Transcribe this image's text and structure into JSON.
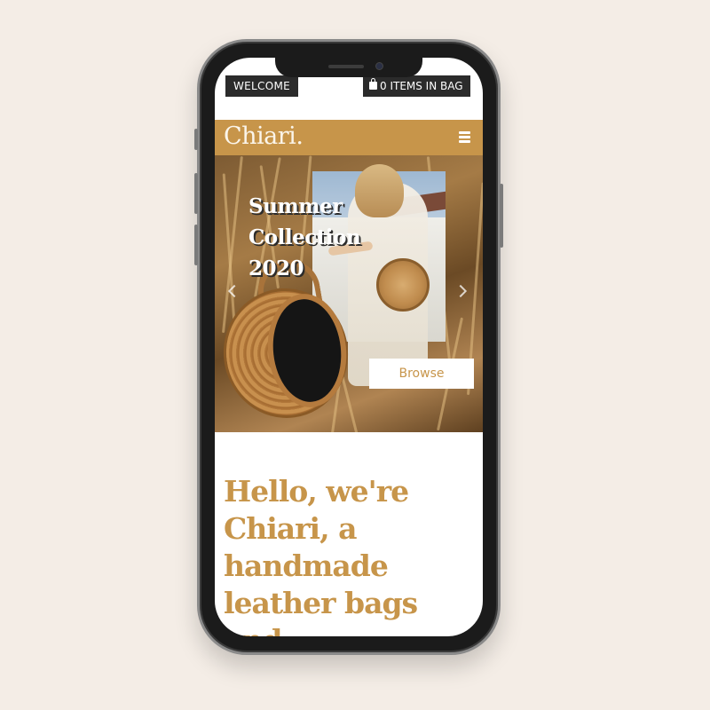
{
  "topbar": {
    "welcome_label": "WELCOME",
    "bag_label": "0 ITEMS IN BAG",
    "bag_icon": "shopping-bag-icon"
  },
  "header": {
    "logo": "Chiari.",
    "menu_icon": "hamburger-menu-icon"
  },
  "hero": {
    "headline_line1": "Summer",
    "headline_line2": "Collection",
    "headline_line3": "2020",
    "browse_label": "Browse",
    "prev_icon": "chevron-left-icon",
    "next_icon": "chevron-right-icon"
  },
  "intro": {
    "text": "Hello, we're Chiari, a handmade leather bags and"
  },
  "colors": {
    "accent": "#c7954a",
    "dark": "#2b2b2b",
    "background": "#f4ede6"
  }
}
